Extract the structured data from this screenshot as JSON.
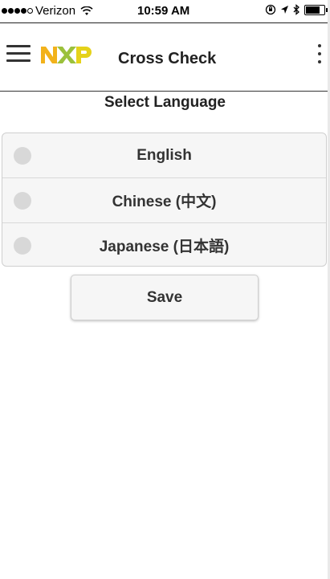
{
  "status_bar": {
    "carrier": "Verizon",
    "signal_bars_filled": 4,
    "signal_bars_total": 5,
    "time": "10:59 AM",
    "battery_level": 0.7
  },
  "header": {
    "app_title": "Cross Check",
    "logo": "NXP",
    "logo_colors": {
      "N": "#f2b21b",
      "X": "#9bc13c",
      "P": "#e5d21a"
    }
  },
  "page": {
    "title": "Select Language"
  },
  "languages": [
    {
      "label": "English",
      "selected": false
    },
    {
      "label": "Chinese (中文)",
      "selected": false
    },
    {
      "label": "Japanese (日本語)",
      "selected": false
    }
  ],
  "actions": {
    "save_label": "Save"
  }
}
